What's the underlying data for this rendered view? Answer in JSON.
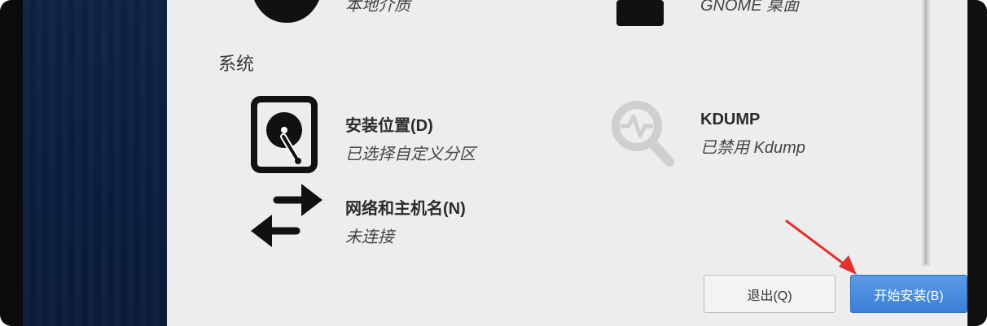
{
  "app": {
    "section_title": "系统"
  },
  "spokes": {
    "install_dest": {
      "title": "安装位置(D)",
      "status": "已选择自定义分区"
    },
    "kdump": {
      "title": "KDUMP",
      "status": "已禁用 Kdump"
    },
    "network": {
      "title": "网络和主机名(N)",
      "status": "未连接"
    }
  },
  "partial_top": {
    "left_status": "本地介质",
    "right_status": "GNOME 桌面"
  },
  "buttons": {
    "quit": "退出(Q)",
    "begin": "开始安装(B)"
  },
  "colors": {
    "sidebar": "#0e2345",
    "content_bg": "#ededed",
    "primary_button": "#3b7fd7",
    "annotation_arrow": "#e23030"
  },
  "icons": {
    "install_dest": "hard-disk-icon",
    "kdump": "kdump-magnifier-icon",
    "network": "network-arrows-icon",
    "arrow": "red-arrow-annotation"
  }
}
